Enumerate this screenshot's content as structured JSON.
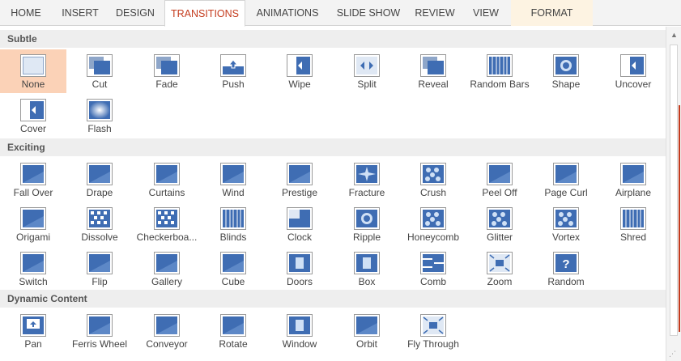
{
  "tabs": [
    "HOME",
    "INSERT",
    "DESIGN",
    "TRANSITIONS",
    "ANIMATIONS",
    "SLIDE SHOW",
    "REVIEW",
    "VIEW",
    "FORMAT"
  ],
  "active_tab": "TRANSITIONS",
  "sections": [
    {
      "title": "Subtle",
      "items": [
        {
          "label": "None",
          "icon": "none-icon",
          "selected": true
        },
        {
          "label": "Cut",
          "icon": "cut-icon"
        },
        {
          "label": "Fade",
          "icon": "fade-icon"
        },
        {
          "label": "Push",
          "icon": "push-icon"
        },
        {
          "label": "Wipe",
          "icon": "wipe-icon"
        },
        {
          "label": "Split",
          "icon": "split-icon"
        },
        {
          "label": "Reveal",
          "icon": "reveal-icon"
        },
        {
          "label": "Random Bars",
          "icon": "random-bars-icon"
        },
        {
          "label": "Shape",
          "icon": "shape-icon"
        },
        {
          "label": "Uncover",
          "icon": "uncover-icon"
        },
        {
          "label": "Cover",
          "icon": "cover-icon"
        },
        {
          "label": "Flash",
          "icon": "flash-icon"
        }
      ]
    },
    {
      "title": "Exciting",
      "items": [
        {
          "label": "Fall Over",
          "icon": "fall-over-icon"
        },
        {
          "label": "Drape",
          "icon": "drape-icon"
        },
        {
          "label": "Curtains",
          "icon": "curtains-icon"
        },
        {
          "label": "Wind",
          "icon": "wind-icon"
        },
        {
          "label": "Prestige",
          "icon": "prestige-icon"
        },
        {
          "label": "Fracture",
          "icon": "fracture-icon"
        },
        {
          "label": "Crush",
          "icon": "crush-icon"
        },
        {
          "label": "Peel Off",
          "icon": "peel-off-icon"
        },
        {
          "label": "Page Curl",
          "icon": "page-curl-icon"
        },
        {
          "label": "Airplane",
          "icon": "airplane-icon"
        },
        {
          "label": "Origami",
          "icon": "origami-icon"
        },
        {
          "label": "Dissolve",
          "icon": "dissolve-icon"
        },
        {
          "label": "Checkerboa...",
          "icon": "checkerboard-icon"
        },
        {
          "label": "Blinds",
          "icon": "blinds-icon"
        },
        {
          "label": "Clock",
          "icon": "clock-icon"
        },
        {
          "label": "Ripple",
          "icon": "ripple-icon"
        },
        {
          "label": "Honeycomb",
          "icon": "honeycomb-icon"
        },
        {
          "label": "Glitter",
          "icon": "glitter-icon"
        },
        {
          "label": "Vortex",
          "icon": "vortex-icon"
        },
        {
          "label": "Shred",
          "icon": "shred-icon"
        },
        {
          "label": "Switch",
          "icon": "switch-icon"
        },
        {
          "label": "Flip",
          "icon": "flip-icon"
        },
        {
          "label": "Gallery",
          "icon": "gallery-icon"
        },
        {
          "label": "Cube",
          "icon": "cube-icon"
        },
        {
          "label": "Doors",
          "icon": "doors-icon"
        },
        {
          "label": "Box",
          "icon": "box-icon"
        },
        {
          "label": "Comb",
          "icon": "comb-icon"
        },
        {
          "label": "Zoom",
          "icon": "zoom-icon"
        },
        {
          "label": "Random",
          "icon": "random-icon"
        }
      ]
    },
    {
      "title": "Dynamic Content",
      "items": [
        {
          "label": "Pan",
          "icon": "pan-icon"
        },
        {
          "label": "Ferris Wheel",
          "icon": "ferris-wheel-icon"
        },
        {
          "label": "Conveyor",
          "icon": "conveyor-icon"
        },
        {
          "label": "Rotate",
          "icon": "rotate-icon"
        },
        {
          "label": "Window",
          "icon": "window-icon"
        },
        {
          "label": "Orbit",
          "icon": "orbit-icon"
        },
        {
          "label": "Fly Through",
          "icon": "fly-through-icon"
        }
      ]
    }
  ],
  "colors": {
    "accent": "#c43b1d",
    "thumb_blue": "#3f6db3",
    "selected_bg": "#fbd2b7",
    "section_bg": "#eeeeee",
    "format_tab_bg": "#fdf3e2"
  }
}
